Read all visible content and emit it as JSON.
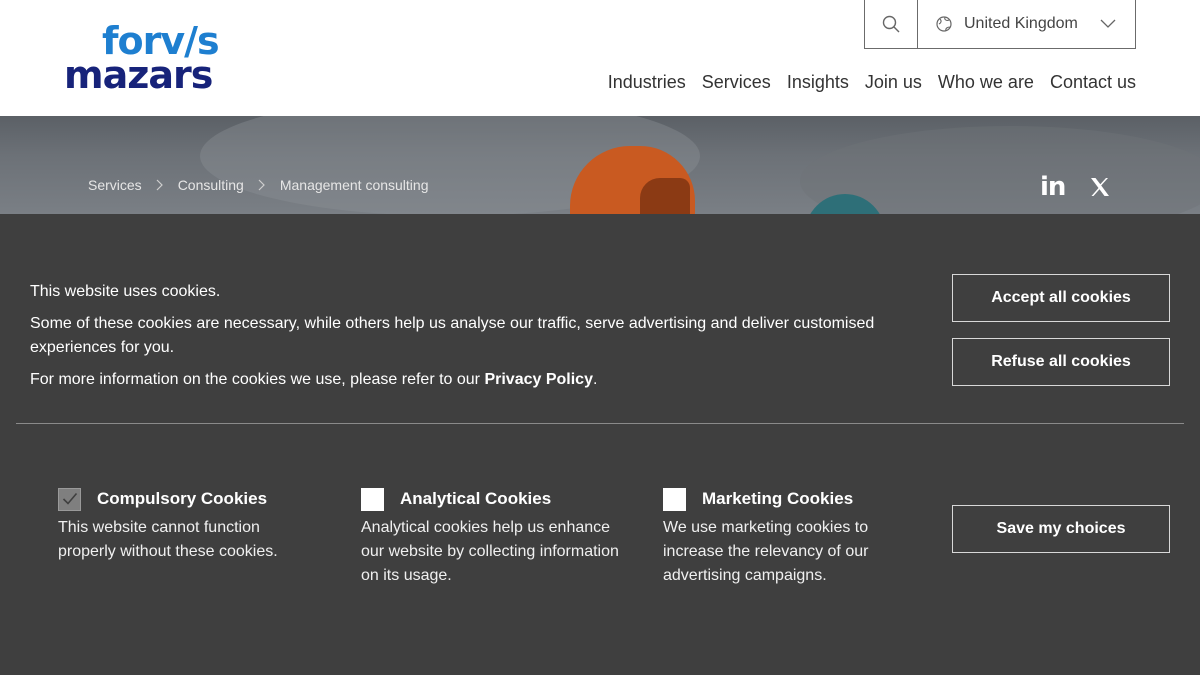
{
  "brand": {
    "logo_line1": "forv/s",
    "logo_line2": "mazars"
  },
  "utility": {
    "region": "United Kingdom"
  },
  "nav": [
    {
      "label": "Industries"
    },
    {
      "label": "Services"
    },
    {
      "label": "Insights"
    },
    {
      "label": "Join us"
    },
    {
      "label": "Who we are"
    },
    {
      "label": "Contact us"
    }
  ],
  "breadcrumb": [
    "Services",
    "Consulting",
    "Management consulting"
  ],
  "social": {
    "linkedin": "in"
  },
  "cookie": {
    "line1": "This website uses cookies.",
    "line2": "Some of these cookies are necessary, while others help us analyse our traffic, serve advertising and deliver customised experiences for you.",
    "line3_prefix": "For more information on the cookies we use, please refer to our ",
    "privacy_link": "Privacy Policy",
    "line3_suffix": ".",
    "accept_label": "Accept all cookies",
    "refuse_label": "Refuse all cookies",
    "save_label": "Save my choices",
    "categories": [
      {
        "title": "Compulsory Cookies",
        "desc": "This website cannot function properly without these cookies.",
        "checked": true
      },
      {
        "title": "Analytical Cookies",
        "desc": "Analytical cookies help us enhance our website by collecting information on its usage.",
        "checked": false
      },
      {
        "title": "Marketing Cookies",
        "desc": "We use marketing cookies to increase the relevancy of our advertising campaigns.",
        "checked": false
      }
    ]
  }
}
